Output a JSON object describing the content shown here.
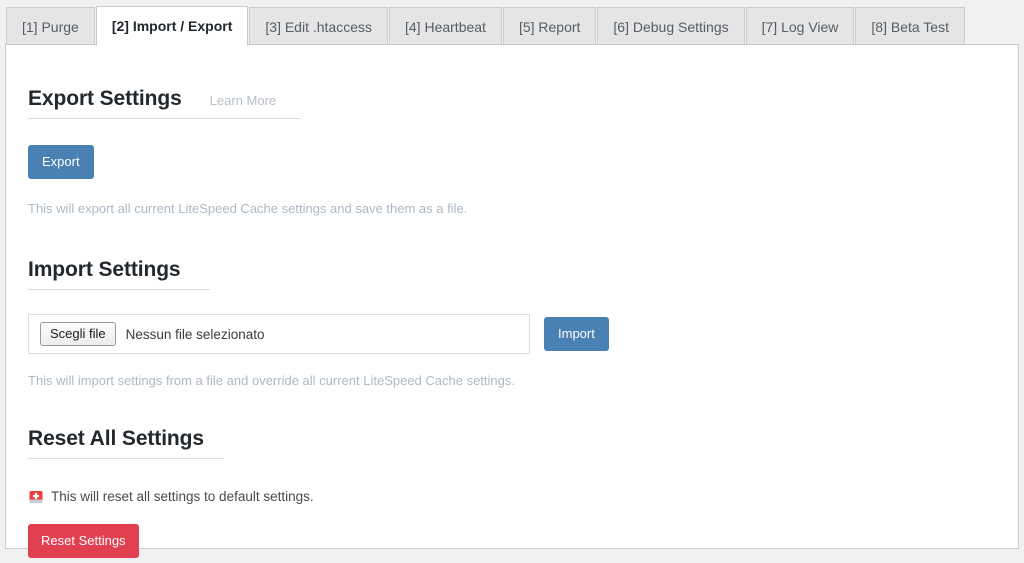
{
  "tabs": [
    {
      "label": "[1] Purge",
      "active": false
    },
    {
      "label": "[2] Import / Export",
      "active": true
    },
    {
      "label": "[3] Edit .htaccess",
      "active": false
    },
    {
      "label": "[4] Heartbeat",
      "active": false
    },
    {
      "label": "[5] Report",
      "active": false
    },
    {
      "label": "[6] Debug Settings",
      "active": false
    },
    {
      "label": "[7] Log View",
      "active": false
    },
    {
      "label": "[8] Beta Test",
      "active": false
    }
  ],
  "export": {
    "heading": "Export Settings",
    "learn_more": "Learn More",
    "button_label": "Export",
    "description": "This will export all current LiteSpeed Cache settings and save them as a file."
  },
  "import": {
    "heading": "Import Settings",
    "file_button_label": "Scegli file",
    "file_status": "Nessun file selezionato",
    "button_label": "Import",
    "description": "This will import settings from a file and override all current LiteSpeed Cache settings."
  },
  "reset": {
    "heading": "Reset All Settings",
    "warning_icon": "warning-alert-icon",
    "warning_text": "This will reset all settings to default settings.",
    "button_label": "Reset Settings"
  },
  "colors": {
    "primary_button": "#4a81b4",
    "danger_button": "#e04050",
    "description_text": "#adb8c4",
    "page_background": "#f1f1f1",
    "panel_background": "#ffffff",
    "warning_icon": "#e8403a"
  }
}
